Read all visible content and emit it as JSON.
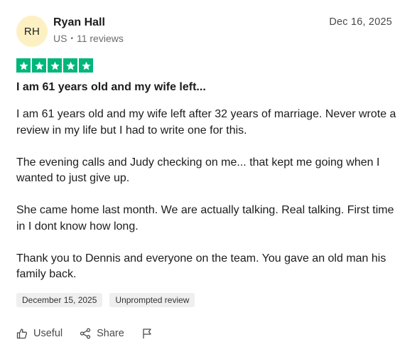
{
  "reviewer": {
    "initials": "RH",
    "name": "Ryan Hall",
    "country": "US",
    "separator": "•",
    "review_count": "11 reviews"
  },
  "review": {
    "date": "Dec 16, 2025",
    "rating": 5,
    "title": "I am 61 years old and my wife left...",
    "paragraphs": [
      "I am 61 years old and my wife left after 32 years of marriage. Never wrote a review in my life but I had to write one for this.",
      "The evening calls and Judy checking on me... that kept me going when I wanted to just give up.",
      "She came home last month. We are actually talking. Real talking. First time in I dont know how long.",
      "Thank you to Dennis and everyone on the team. You gave an old man his family back."
    ],
    "tags": [
      "December 15, 2025",
      "Unprompted review"
    ]
  },
  "actions": {
    "useful_label": "Useful",
    "share_label": "Share"
  },
  "colors": {
    "star_green": "#00b67a",
    "avatar_bg": "#fdf1c3",
    "tag_bg": "#efefef"
  },
  "icons": {
    "star": "star-icon",
    "useful": "thumbs-up-icon",
    "share": "share-icon",
    "report": "flag-icon"
  }
}
